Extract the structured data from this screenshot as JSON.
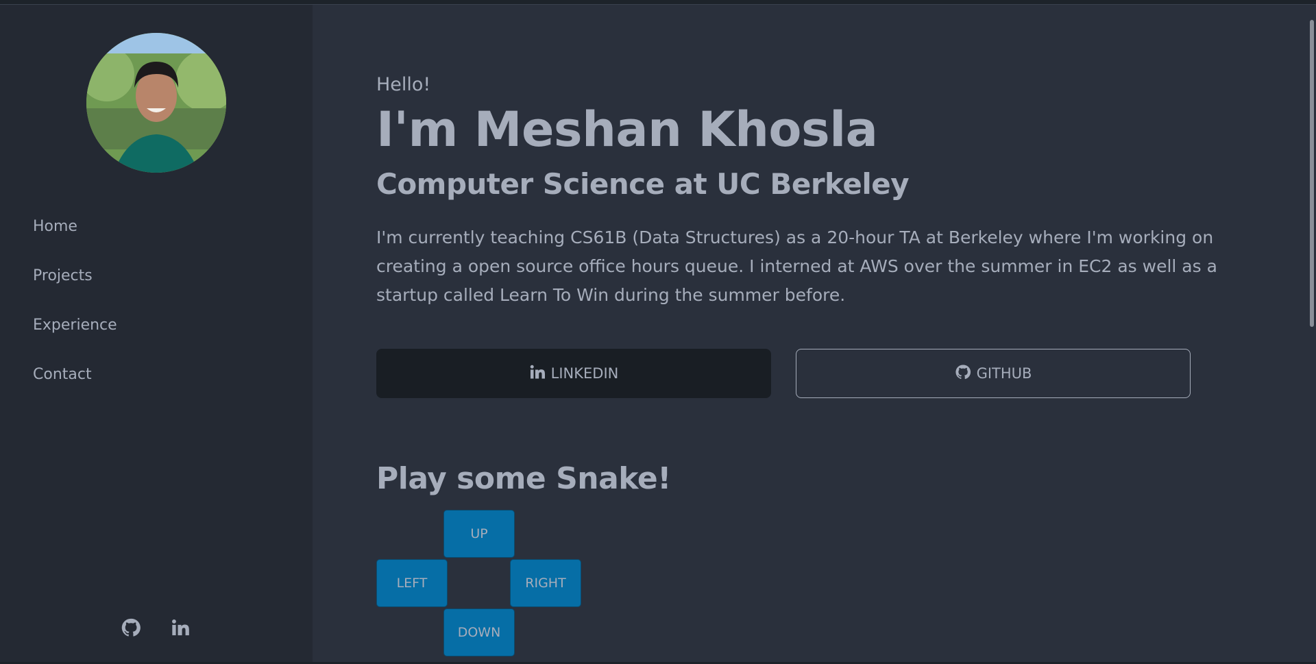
{
  "sidebar": {
    "nav": [
      "Home",
      "Projects",
      "Experience",
      "Contact"
    ],
    "social_icons": [
      "github-icon",
      "linkedin-icon"
    ]
  },
  "hero": {
    "greeting": "Hello!",
    "name": "I'm Meshan Khosla",
    "subtitle": "Computer Science at UC Berkeley",
    "bio": "I'm currently teaching CS61B (Data Structures) as a 20-hour TA at Berkeley where I'm working on creating a open source office hours queue. I interned at AWS over the summer in EC2 as well as a startup called Learn To Win during the summer before."
  },
  "buttons": {
    "linkedin": "LINKEDIN",
    "github": "GITHUB"
  },
  "snake": {
    "title": "Play some Snake!",
    "up": "UP",
    "left": "LEFT",
    "right": "RIGHT",
    "down": "DOWN"
  },
  "colors": {
    "background": "#2a303c",
    "sidebar": "#242933",
    "text": "#a6adbb",
    "dpad": "#066ea6",
    "dark_button": "#191e24"
  }
}
